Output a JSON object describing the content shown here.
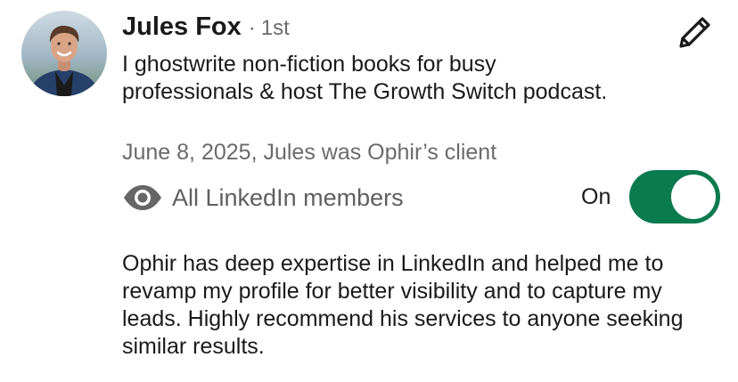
{
  "recommendation": {
    "author": {
      "name": "Jules Fox",
      "separator": "·",
      "degree": "1st",
      "avatar_icon": "profile-photo",
      "headline": "I ghostwrite non-fiction books for busy professionals & host The Growth Switch podcast."
    },
    "date_relation": "June 8, 2025, Jules was Ophir’s client",
    "edit_icon": "pencil-icon",
    "visibility": {
      "icon": "eye-icon",
      "label": "All LinkedIn members",
      "toggle_label": "On",
      "toggle_on": true,
      "toggle_color": "#0a7a4f"
    },
    "text": "Ophir has deep expertise in LinkedIn and helped me to revamp my profile for better visibility and to capture my leads. Highly recommend his services to anyone seeking similar results."
  }
}
